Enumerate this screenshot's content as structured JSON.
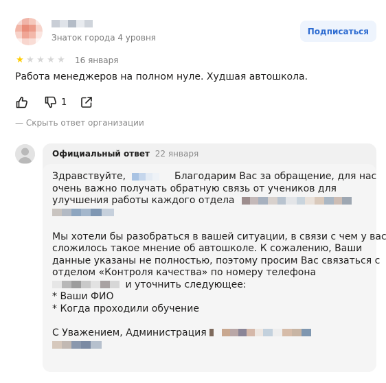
{
  "review": {
    "author_level": "Знаток города 4 уровня",
    "subscribe_label": "Подписаться",
    "rating": 1,
    "rating_max": 5,
    "date": "16 января",
    "text": "Работа менеджеров на полном нуле. Худшая автошкола.",
    "dislike_count": "1",
    "hide_answer_label": "— Скрыть ответ организации"
  },
  "answer": {
    "title": "Официальный ответ",
    "date": "22 января",
    "greeting": "Здравствуйте,",
    "p1_line1_after": "Благодарим Вас за обращение, для нас",
    "p1_line2": "очень важно получать обратную связь от учеников для",
    "p1_line3": "улучшения работы каждого отдела",
    "p2_line1": "Мы хотели бы разобраться в вашей ситуации, в связи с чем у вас",
    "p2_line2": "сложилось такое мнение об автошколе. К сожалению, Ваши",
    "p2_line3": "данные указаны не полностью, поэтому просим Вас связаться с",
    "p2_line4": "отделом «Контроля качества» по номеру телефона",
    "p2_line5_after": "и уточнить следующее:",
    "item1": "* Ваши ФИО",
    "item2": "* Когда проходили обучение",
    "signature": "С Уважением, Администрация"
  },
  "icons": {
    "star": "star-icon",
    "like": "thumbs-up-icon",
    "dislike": "thumbs-down-icon",
    "share": "share-icon",
    "org_avatar": "default-user-avatar-icon"
  },
  "colors": {
    "star_on": "#ffcc00",
    "star_off": "#d6d6d6",
    "subscribe_bg": "#eef4fd",
    "subscribe_text": "#2e6cd1",
    "answer_bg": "#f1f1f1",
    "muted_text": "#7a7a7a"
  }
}
